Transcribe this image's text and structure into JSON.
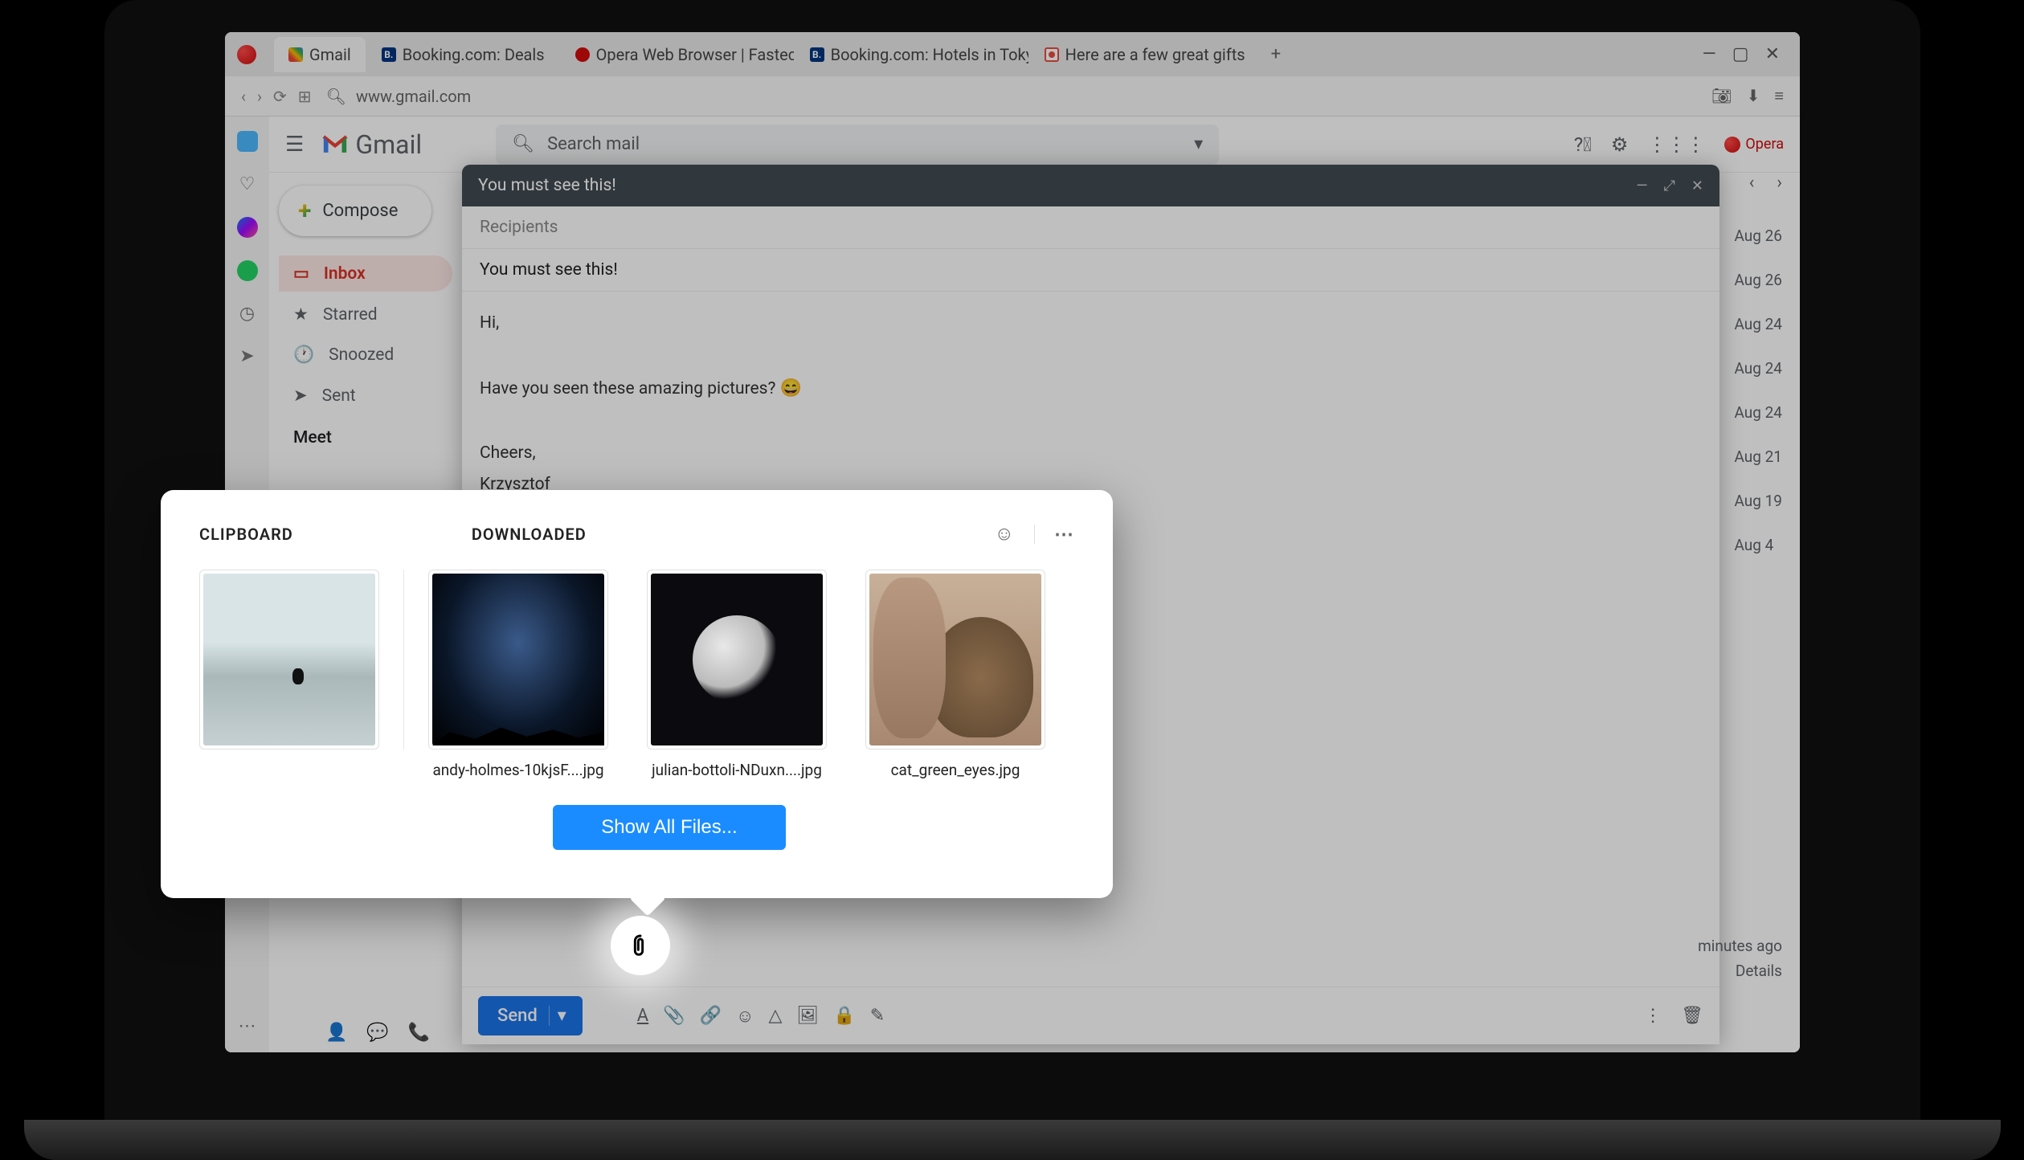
{
  "browser": {
    "tabs": [
      {
        "label": "Gmail",
        "icon": "gmail",
        "active": true
      },
      {
        "label": "Booking.com: Deals",
        "icon": "booking"
      },
      {
        "label": "Opera Web Browser | Fastec",
        "icon": "opera"
      },
      {
        "label": "Booking.com: Hotels in Toky",
        "icon": "booking"
      },
      {
        "label": "Here are a few great gifts",
        "icon": "red-dot"
      }
    ],
    "new_tab": "+",
    "window": {
      "min": "—",
      "max": "▢",
      "close": "✕"
    },
    "address": {
      "url": "www.gmail.com"
    }
  },
  "gmail": {
    "logo_text": "Gmail",
    "search_placeholder": "Search mail",
    "compose_btn": "Compose",
    "nav": [
      {
        "label": "Inbox",
        "active": true
      },
      {
        "label": "Starred"
      },
      {
        "label": "Snoozed"
      },
      {
        "label": "Sent"
      }
    ],
    "meet_label": "Meet",
    "dates": [
      "Aug 26",
      "Aug 26",
      "Aug 24",
      "Aug 24",
      "Aug 24",
      "Aug 21",
      "Aug 19",
      "Aug 4"
    ],
    "footer_minutes": "minutes ago",
    "footer_details": "Details"
  },
  "compose": {
    "title": "You must see this!",
    "recipients_placeholder": "Recipients",
    "subject": "You must see this!",
    "body_greeting": "Hi,",
    "body_line": "Have you seen these amazing pictures?",
    "body_emoji": "😄",
    "body_signoff": "Cheers,",
    "body_name": "Krzysztof",
    "send": "Send"
  },
  "picker": {
    "clipboard_label": "CLIPBOARD",
    "downloaded_label": "DOWNLOADED",
    "files": [
      {
        "caption": "andy-holmes-10kjsF....jpg"
      },
      {
        "caption": "julian-bottoli-NDuxn....jpg"
      },
      {
        "caption": "cat_green_eyes.jpg"
      }
    ],
    "show_all": "Show All Files..."
  }
}
